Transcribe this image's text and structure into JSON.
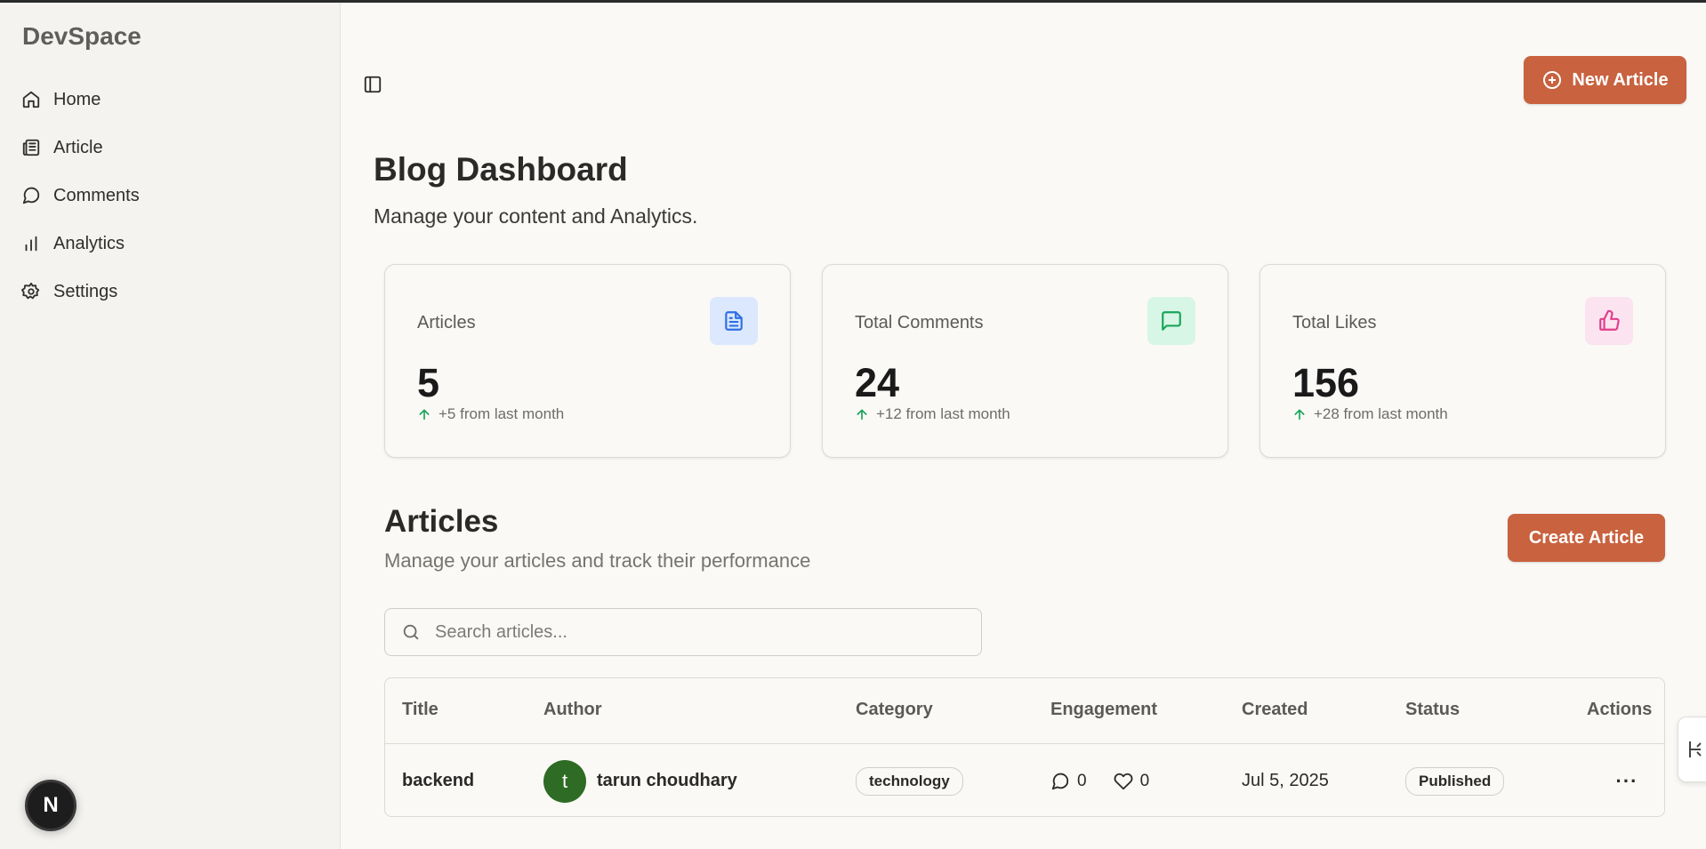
{
  "app": {
    "brand": "DevSpace"
  },
  "sidebar": {
    "items": [
      {
        "label": "Home",
        "icon": "home-icon"
      },
      {
        "label": "Article",
        "icon": "newspaper-icon"
      },
      {
        "label": "Comments",
        "icon": "message-circle-icon"
      },
      {
        "label": "Analytics",
        "icon": "bar-chart-icon"
      },
      {
        "label": "Settings",
        "icon": "gear-icon"
      }
    ],
    "badge": "N"
  },
  "header": {
    "new_article_label": "New Article"
  },
  "dashboard": {
    "title": "Blog Dashboard",
    "subtitle": "Manage your content and Analytics."
  },
  "stats": [
    {
      "label": "Articles",
      "value": "5",
      "trend": "+5 from last month",
      "icon": "file-text-icon",
      "color": "#2f6fe4"
    },
    {
      "label": "Total Comments",
      "value": "24",
      "trend": "+12 from last month",
      "icon": "message-square-icon",
      "color": "#17a55a"
    },
    {
      "label": "Total Likes",
      "value": "156",
      "trend": "+28 from last month",
      "icon": "thumbs-up-icon",
      "color": "#df3f8d"
    }
  ],
  "articles": {
    "title": "Articles",
    "subtitle": "Manage your articles and track their performance",
    "create_label": "Create Article",
    "search_placeholder": "Search articles...",
    "columns": [
      "Title",
      "Author",
      "Category",
      "Engagement",
      "Created",
      "Status",
      "Actions"
    ],
    "rows": [
      {
        "title": "backend",
        "author_initial": "t",
        "author": "tarun choudhary",
        "category": "technology",
        "comments": "0",
        "likes": "0",
        "created": "Jul 5, 2025",
        "status": "Published",
        "actions": "···"
      }
    ]
  },
  "colors": {
    "accent": "#c8623f",
    "avatar": "#2e6b24"
  }
}
